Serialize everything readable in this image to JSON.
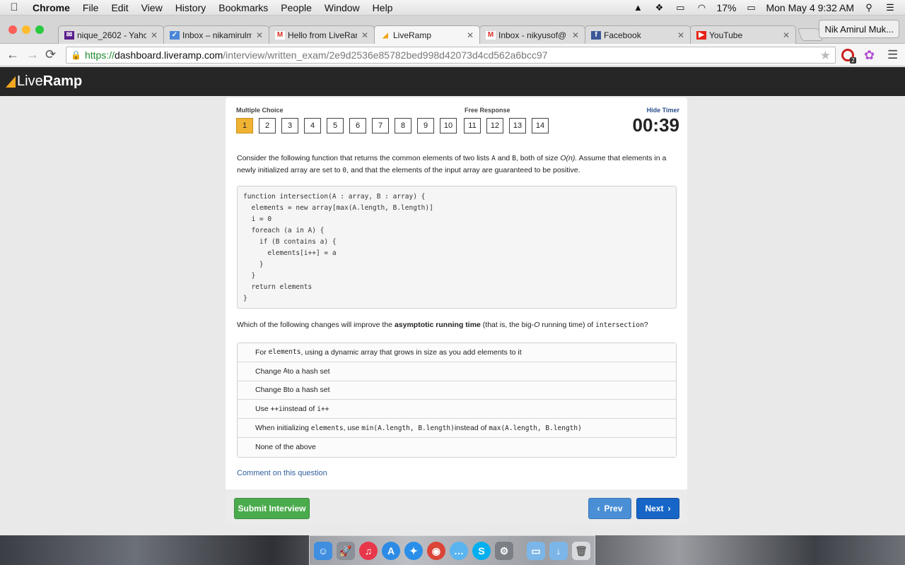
{
  "menubar": {
    "app": "Chrome",
    "items": [
      "File",
      "Edit",
      "View",
      "History",
      "Bookmarks",
      "People",
      "Window",
      "Help"
    ],
    "battery": "17%",
    "clock": "Mon May 4  9:32 AM"
  },
  "tabs": [
    {
      "title": "nique_2602 - Yahc",
      "icon": "yahoo-mail-icon",
      "color": "#5b1c8c"
    },
    {
      "title": "Inbox – nikamirulm",
      "icon": "inbox-icon",
      "color": "#4b86d8"
    },
    {
      "title": "Hello from LiveRar",
      "icon": "gmail-icon",
      "color": "#d93025"
    },
    {
      "title": "LiveRamp",
      "icon": "liveramp-icon",
      "color": "#f3a71e"
    },
    {
      "title": "Inbox - nikyusof@",
      "icon": "gmail-icon",
      "color": "#d93025"
    },
    {
      "title": "Facebook",
      "icon": "facebook-icon",
      "color": "#3b5998"
    },
    {
      "title": "YouTube",
      "icon": "youtube-icon",
      "color": "#e62117"
    }
  ],
  "profile_name": "Nik Amirul Muk...",
  "url": {
    "scheme": "https://",
    "host": "dashboard.liveramp.com",
    "path": "/interview/written_exam/2e9d2536e85782bed998d42073d4cd562a6bcc97"
  },
  "extension_badge": "2",
  "brand": {
    "light": "Live",
    "bold": "Ramp"
  },
  "exam": {
    "mc_label": "Multiple Choice",
    "fr_label": "Free Response",
    "hide_timer": "Hide Timer",
    "timer": "00:39",
    "current_question": 1,
    "question_numbers": [
      "1",
      "2",
      "3",
      "4",
      "5",
      "6",
      "7",
      "8",
      "9",
      "10",
      "11",
      "12",
      "13",
      "14"
    ],
    "prompt_part1": "Consider the following function that returns the common elements of two lists ",
    "prompt_A": "A",
    "prompt_and": " and ",
    "prompt_B": "B",
    "prompt_part2": ", both of size ",
    "prompt_size": "O(n).",
    "prompt_part3": " Assume that elements in a newly initialized array are set to ",
    "prompt_zero": "0",
    "prompt_part4": ", and that the elements of the input array are guaranteed to be positive.",
    "code": "function intersection(A : array, B : array) {\n  elements = new array[max(A.length, B.length)]\n  i = 0\n  foreach (a in A) {\n    if (B contains a) {\n      elements[i++] = a\n    }\n  }\n  return elements\n}",
    "q2_part1": "Which of the following changes will improve the ",
    "q2_bold": "asymptotic running time",
    "q2_part2": " (that is, the big-",
    "q2_O": "O",
    "q2_part3": " running time) of ",
    "q2_fn": "intersection",
    "q2_part4": "?",
    "options": [
      {
        "pre": "For ",
        "code": "elements",
        "post": ", using a dynamic array that grows in size as you add elements to it"
      },
      {
        "pre": "Change ",
        "code": "A",
        "post": " to a hash set"
      },
      {
        "pre": "Change ",
        "code": "B",
        "post": " to a hash set"
      },
      {
        "pre": "Use ",
        "code": "++i",
        "post": " instead of ",
        "code2": "i++"
      },
      {
        "pre": "When initializing ",
        "code": "elements",
        "post": ", use ",
        "code2": "min(A.length, B.length)",
        "post2": " instead of ",
        "code3": "max(A.length, B.length)"
      },
      {
        "pre": "None of the above"
      }
    ],
    "comment_link": "Comment on this question",
    "submit_label": "Submit Interview",
    "prev_label": "Prev",
    "next_label": "Next"
  },
  "dock": [
    {
      "name": "finder-icon",
      "color": "#3f8ee0",
      "glyph": "☺"
    },
    {
      "name": "launchpad-icon",
      "color": "#8a8f98",
      "glyph": "🚀"
    },
    {
      "name": "itunes-icon",
      "color": "#e8364a",
      "glyph": "♫"
    },
    {
      "name": "app-store-icon",
      "color": "#2d8be6",
      "glyph": "A"
    },
    {
      "name": "safari-icon",
      "color": "#2a8fe8",
      "glyph": "✦"
    },
    {
      "name": "chrome-icon",
      "color": "#db4437",
      "glyph": "◉"
    },
    {
      "name": "messages-icon",
      "color": "#5ab4f0",
      "glyph": "…"
    },
    {
      "name": "skype-icon",
      "color": "#00aff0",
      "glyph": "S"
    },
    {
      "name": "system-preferences-icon",
      "color": "#7b7f86",
      "glyph": "⚙"
    },
    {
      "name": "applications-folder-icon",
      "color": "#7cb6e8",
      "glyph": "▭"
    },
    {
      "name": "downloads-folder-icon",
      "color": "#7cb6e8",
      "glyph": "↓"
    },
    {
      "name": "trash-icon",
      "color": "#d9dadd",
      "glyph": "🗑"
    }
  ]
}
